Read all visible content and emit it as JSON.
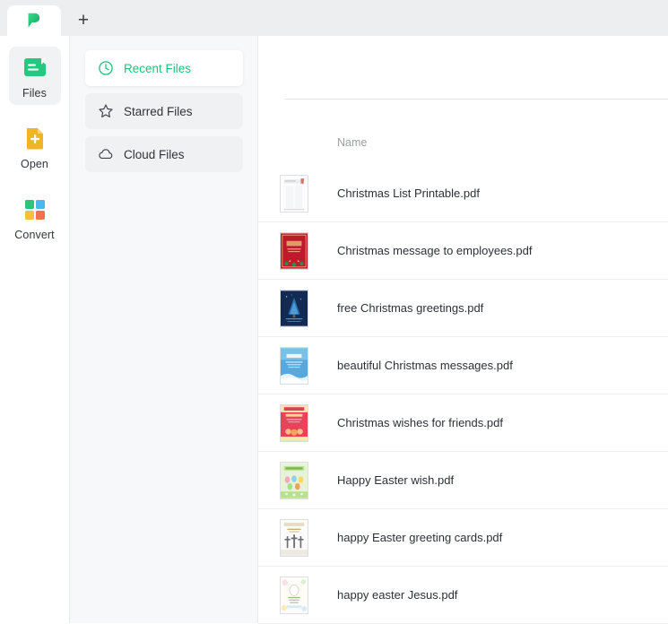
{
  "tabbar": {
    "active_tab_icon": "pdf-app-logo",
    "new_tab_label": "+",
    "background": "#eceef0"
  },
  "rail": {
    "items": [
      {
        "label": "Files",
        "icon": "files-icon",
        "active": true,
        "color": "#22c97e"
      },
      {
        "label": "Open",
        "icon": "open-icon",
        "active": false,
        "color": "#f0b429"
      },
      {
        "label": "Convert",
        "icon": "convert-icon",
        "active": false,
        "color": "#4caf50"
      }
    ]
  },
  "nav": {
    "items": [
      {
        "label": "Recent Files",
        "icon": "clock-icon",
        "active": true
      },
      {
        "label": "Starred Files",
        "icon": "star-icon",
        "active": false
      },
      {
        "label": "Cloud Files",
        "icon": "cloud-icon",
        "active": false
      }
    ],
    "accent": "#21c07a"
  },
  "main": {
    "column_header_name": "Name",
    "files": [
      {
        "name": "Christmas List Printable.pdf",
        "thumb": "christmas-list-printable-thumb"
      },
      {
        "name": "Christmas message to employees.pdf",
        "thumb": "christmas-message-employees-thumb"
      },
      {
        "name": "free Christmas greetings.pdf",
        "thumb": "free-christmas-greetings-thumb"
      },
      {
        "name": "beautiful Christmas messages.pdf",
        "thumb": "beautiful-christmas-messages-thumb"
      },
      {
        "name": "Christmas wishes for friends.pdf",
        "thumb": "christmas-wishes-friends-thumb"
      },
      {
        "name": "Happy Easter wish.pdf",
        "thumb": "happy-easter-wish-thumb"
      },
      {
        "name": "happy Easter greeting cards.pdf",
        "thumb": "happy-easter-greeting-cards-thumb"
      },
      {
        "name": "happy easter Jesus.pdf",
        "thumb": "happy-easter-jesus-thumb"
      }
    ]
  }
}
